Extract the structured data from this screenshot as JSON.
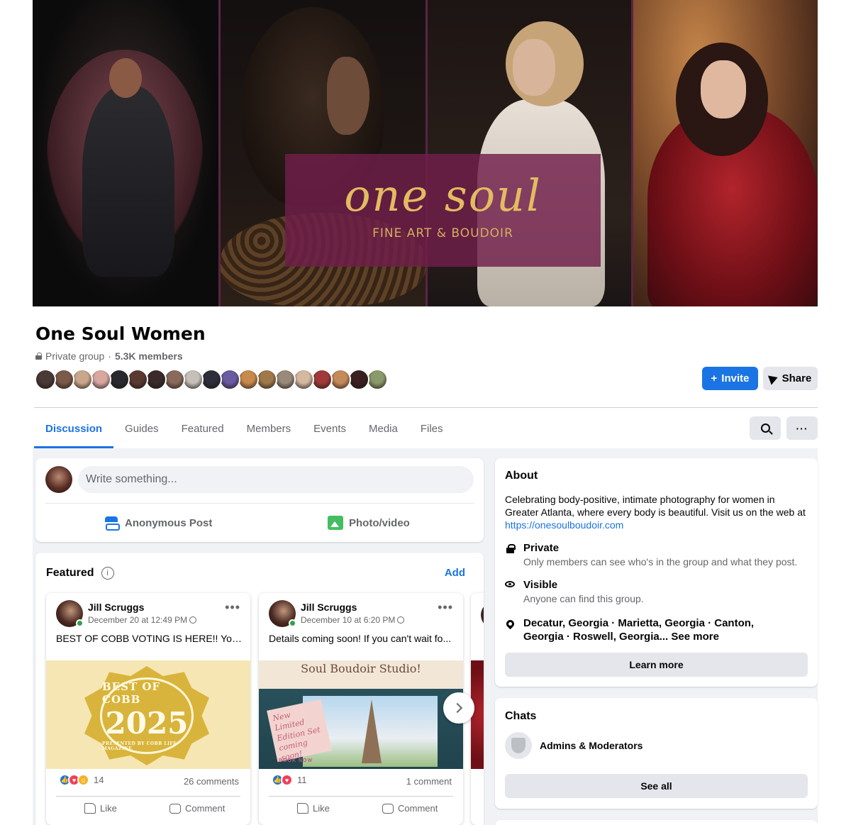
{
  "cover": {
    "logo_script": "one soul",
    "logo_sub": "FINE ART & BOUDOIR"
  },
  "group": {
    "name": "One Soul Women",
    "privacy": "Private group",
    "separator": "·",
    "members": "5.3K members",
    "member_avatar_colors": [
      "#4a3a36",
      "#7a5a48",
      "#c9a78c",
      "#d8a7a0",
      "#2a2a2e",
      "#5a3a30",
      "#3a2a2a",
      "#8a6a5a",
      "#c6c0b8",
      "#2e2e3a",
      "#6a5aa0",
      "#c78a4a",
      "#a0794a",
      "#9a8a7a",
      "#d4b8a0",
      "#a03a3a",
      "#c58a5a",
      "#3a2020",
      "#8a9a6a"
    ]
  },
  "actions": {
    "invite": "Invite",
    "invite_icon": "+",
    "share": "Share"
  },
  "tabs": [
    "Discussion",
    "Guides",
    "Featured",
    "Members",
    "Events",
    "Media",
    "Files"
  ],
  "tab_more_icon": "···",
  "composer": {
    "placeholder": "Write something...",
    "anonymous": "Anonymous Post",
    "photo": "Photo/video"
  },
  "featured": {
    "title": "Featured",
    "info_icon": "i",
    "add": "Add",
    "posts": [
      {
        "author": "Jill Scruggs",
        "date": "December 20 at 12:49 PM",
        "text": "BEST OF COBB VOTING IS HERE!! You ca...",
        "image": {
          "line1": "BEST OF COBB",
          "line2": "2025",
          "line3": "PRESENTED BY COBB LIFE MAGAZINE"
        },
        "reaction_count": "14",
        "comments": "26 comments",
        "like": "Like",
        "comment": "Comment"
      },
      {
        "author": "Jill Scruggs",
        "date": "December 10 at 6:20 PM",
        "text": "Details coming soon! If you can't wait fo...",
        "image": {
          "title": "Soul Boudoir Studio!",
          "note": "New Limited Edition Set coming soon!",
          "book": "BOOK NOW"
        },
        "reaction_count": "11",
        "comments": "1 comment",
        "like": "Like",
        "comment": "Comment"
      }
    ],
    "post_menu_icon": "•••"
  },
  "about": {
    "title": "About",
    "description": "Celebrating body-positive, intimate photography for women in Greater Atlanta, where every body is beautiful. Visit us on the web at",
    "link": "https://onesoulboudoir.com",
    "private_title": "Private",
    "private_desc": "Only members can see who's in the group and what they post.",
    "visible_title": "Visible",
    "visible_desc": "Anyone can find this group.",
    "locations": "Decatur, Georgia · Marietta, Georgia · Canton, Georgia · Roswell, Georgia...",
    "see_more": "See more",
    "learn_more": "Learn more"
  },
  "chats": {
    "title": "Chats",
    "channel": "Admins & Moderators",
    "see_all": "See all"
  },
  "colors": {
    "accent": "#1b74e4",
    "online": "#31a24c",
    "secondary_text": "#65676b"
  }
}
